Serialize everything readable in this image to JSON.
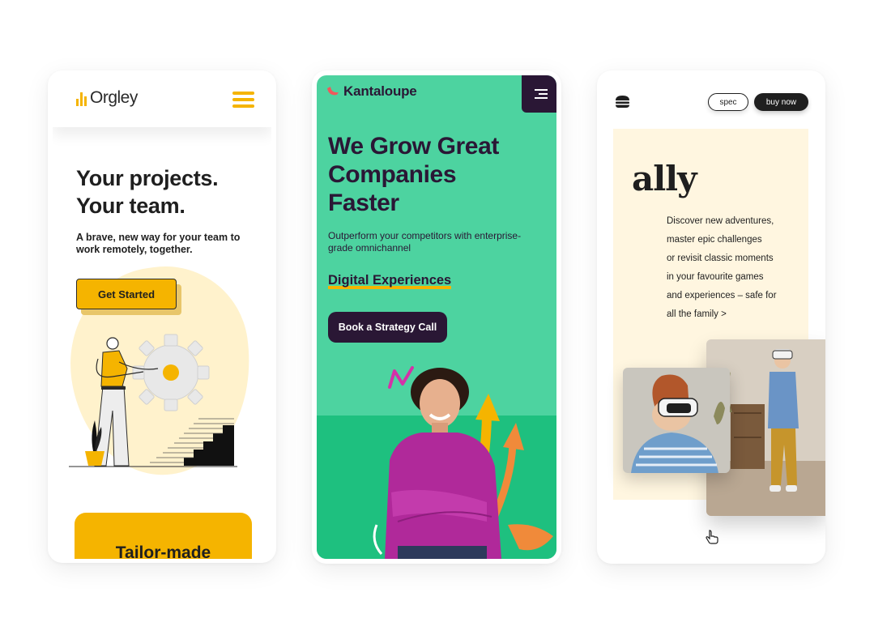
{
  "orgley": {
    "logo_text": "Orgley",
    "headline_line1": "Your projects.",
    "headline_line2": "Your team.",
    "subheadline": "A brave, new way for your team to work remotely, together.",
    "cta_label": "Get Started",
    "card_title": "Tailor-made",
    "colors": {
      "accent": "#F5B400",
      "blob": "#FFF2CC",
      "text": "#1f1f1f"
    },
    "icons": {
      "menu": "hamburger-menu-icon",
      "logo": "bar-chart-logo-icon"
    }
  },
  "kantaloupe": {
    "logo_text": "Kantaloupe",
    "headline_line1": "We Grow Great",
    "headline_line2": "Companies",
    "headline_line3": "Faster",
    "lead": "Outperform your competitors with enterprise-grade omnichannel",
    "highlight": "Digital Experiences",
    "cta_label": "Book a Strategy Call",
    "colors": {
      "background": "#4DD3A0",
      "floor": "#1EC07F",
      "dark": "#2A1735",
      "underline": "#F5B400"
    },
    "icons": {
      "menu": "menu-lines-icon",
      "logo": "melon-slice-logo-icon"
    }
  },
  "ally": {
    "brand": "ally",
    "spec_label": "spec",
    "buy_label": "buy now",
    "paragraph_lines": [
      "Discover new adventures,",
      "master epic challenges",
      "or revisit classic moments",
      "in your favourite games",
      "and experiences – safe for",
      "all the family >"
    ],
    "colors": {
      "panel": "#FFF6E0",
      "dark": "#1f1f1f"
    },
    "icons": {
      "menu": "burger-stack-icon",
      "cursor": "hand-pointer-icon"
    }
  }
}
